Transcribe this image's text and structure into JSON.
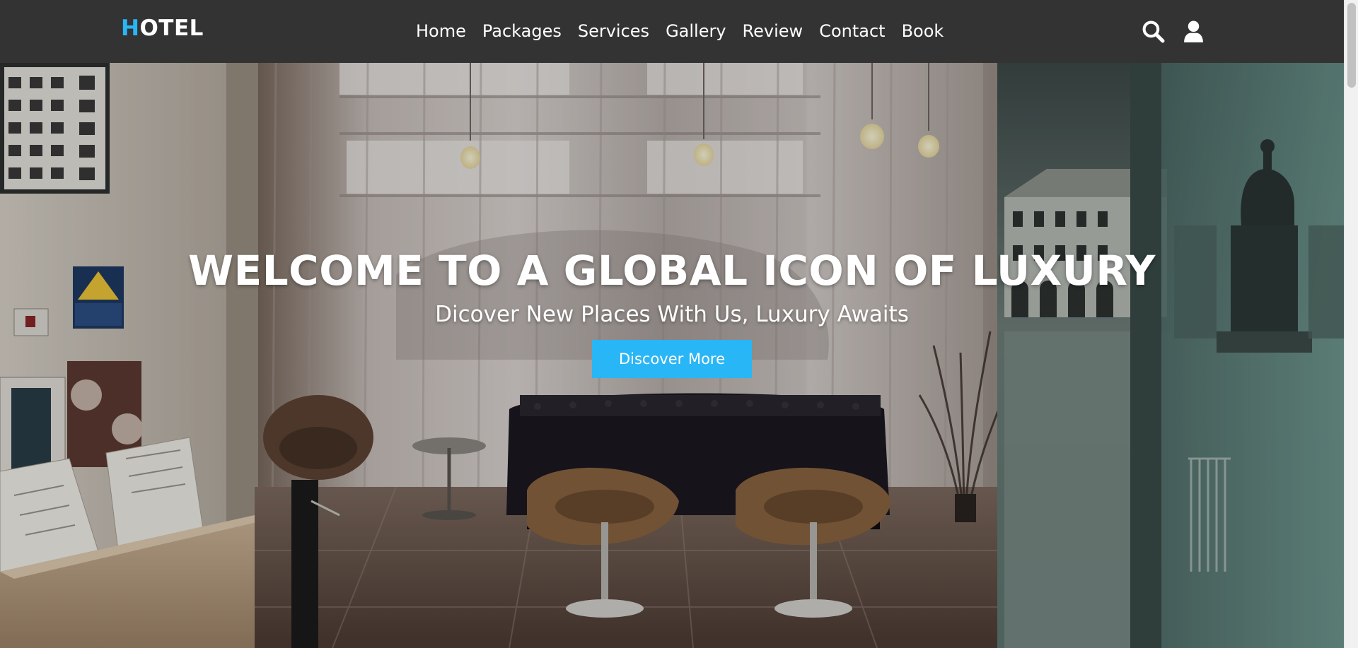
{
  "header": {
    "logo_accent": "H",
    "logo_rest": "OTEL",
    "nav": [
      {
        "label": "Home"
      },
      {
        "label": "Packages"
      },
      {
        "label": "Services"
      },
      {
        "label": "Gallery"
      },
      {
        "label": "Review"
      },
      {
        "label": "Contact"
      },
      {
        "label": "Book"
      }
    ],
    "icons": [
      "search-icon",
      "user-icon"
    ]
  },
  "hero": {
    "title": "WELCOME TO A GLOBAL ICON OF LUXURY",
    "subtitle": "Dicover New Places With Us, Luxury Awaits",
    "button_label": "Discover More"
  },
  "colors": {
    "accent": "#29b6f6",
    "header_bg": "#333333",
    "text": "#ffffff"
  }
}
